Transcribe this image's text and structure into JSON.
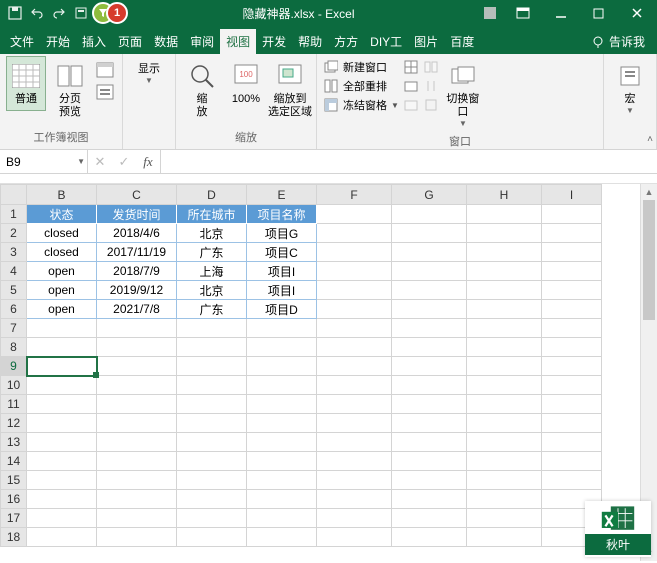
{
  "title": "隐藏神器.xlsx - Excel",
  "badge": {
    "green": "",
    "red": "1"
  },
  "tabs": {
    "file": "文件",
    "home": "开始",
    "insert": "插入",
    "layout": "页面",
    "data": "数据",
    "review": "审阅",
    "view": "视图",
    "dev": "开发",
    "help": "帮助",
    "fang": "方方",
    "diy": "DIY工",
    "pic": "图片",
    "baidu": "百度",
    "tellme": "告诉我"
  },
  "ribbon": {
    "normal": "普通",
    "preview": "分页\n预览",
    "show": "显示",
    "zoom": "缩\n放",
    "zoom100": "100%",
    "zoomsel": "缩放到\n选定区域",
    "newwin": "新建窗口",
    "arrange": "全部重排",
    "freeze": "冻结窗格",
    "switch": "切换窗口",
    "macro": "宏",
    "g_views": "工作簿视图",
    "g_zoom": "缩放",
    "g_window": "窗口"
  },
  "namebox": "B9",
  "chart_data": {
    "type": "table",
    "headers": [
      "状态",
      "发货时间",
      "所在城市",
      "项目名称"
    ],
    "rows": [
      [
        "closed",
        "2018/4/6",
        "北京",
        "项目G"
      ],
      [
        "closed",
        "2017/11/19",
        "广东",
        "项目C"
      ],
      [
        "open",
        "2018/7/9",
        "上海",
        "项目I"
      ],
      [
        "open",
        "2019/9/12",
        "北京",
        "项目I"
      ],
      [
        "open",
        "2021/7/8",
        "广东",
        "项目D"
      ]
    ]
  },
  "cols": [
    "B",
    "C",
    "D",
    "E",
    "F",
    "G",
    "H",
    "I"
  ],
  "rownums": [
    1,
    2,
    3,
    4,
    5,
    6,
    7,
    8,
    9,
    10,
    11,
    12,
    13,
    14,
    15,
    16,
    17,
    18
  ],
  "watermark": "秋叶"
}
